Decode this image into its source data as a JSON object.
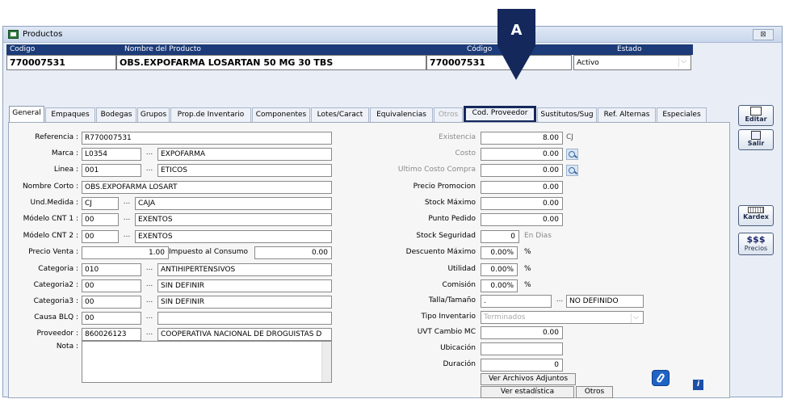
{
  "window": {
    "title": "Productos",
    "close": "⊠"
  },
  "header": {
    "codigo_label": "Codigo",
    "nombre_label": "Nombre del Producto",
    "codigo2_label": "Código",
    "estado_label": "Estado",
    "codigo_value": "770007531",
    "nombre_value": "OBS.EXPOFARMA LOSARTAN 50 MG 30 TBS",
    "codigo2_value": "770007531",
    "estado_value": "Activo"
  },
  "callout": {
    "text": "A"
  },
  "tabs": [
    "General",
    "Empaques",
    "Bodegas",
    "Grupos",
    "Prop.de Inventario",
    "Componentes",
    "Lotes/Caract",
    "Equivalencias",
    "Otros",
    "Cod. Proveedor",
    "Sustitutos/Sug",
    "Ref. Alternas",
    "Especiales"
  ],
  "left": {
    "referencia_label": "Referencia :",
    "referencia": "R770007531",
    "marca_label": "Marca :",
    "marca_code": "L0354",
    "marca_name": "EXPOFARMA",
    "linea_label": "Linea :",
    "linea_code": "001",
    "linea_name": "ETICOS",
    "nombre_corto_label": "Nombre Corto :",
    "nombre_corto": "OBS.EXPOFARMA LOSART",
    "und_label": "Und.Medida :",
    "und_code": "CJ",
    "und_name": "CAJA",
    "cnt1_label": "Módelo CNT 1 :",
    "cnt1_code": "00",
    "cnt1_name": "EXENTOS",
    "cnt2_label": "Módelo CNT 2 :",
    "cnt2_code": "00",
    "cnt2_name": "EXENTOS",
    "precio_label": "Precio Venta :",
    "precio": "1.00",
    "impuesto_label": "Impuesto al Consumo",
    "impuesto": "0.00",
    "cat_label": "Categoria :",
    "cat_code": "010",
    "cat_name": "ANTIHIPERTENSIVOS",
    "cat2_label": "Categoria2 :",
    "cat2_code": "00",
    "cat2_name": "SIN DEFINIR",
    "cat3_label": "Categoria3 :",
    "cat3_code": "00",
    "cat3_name": "SIN DEFINIR",
    "causa_label": "Causa BLQ :",
    "causa_code": "00",
    "causa_name": "",
    "proveedor_label": "Proveedor :",
    "proveedor_code": "860026123",
    "proveedor_name": "COOPERATIVA NACIONAL DE DROGUISTAS D",
    "nota_label": "Nota :",
    "dots": "..."
  },
  "right": {
    "existencia_label": "Existencia",
    "existencia": "8.00",
    "existencia_unit": "CJ",
    "costo_label": "Costo",
    "costo": "0.00",
    "ultimo_costo_label": "Ultimo Costo Compra",
    "ultimo_costo": "0.00",
    "precio_promo_label": "Precio Promocion",
    "precio_promo": "0.00",
    "stock_max_label": "Stock Máximo",
    "stock_max": "0.00",
    "punto_pedido_label": "Punto Pedido",
    "punto_pedido": "0.00",
    "stock_seg_label": "Stock Seguridad",
    "stock_seg": "0",
    "stock_seg_unit": "En Dias",
    "desc_max_label": "Descuento Máximo",
    "desc_max": "0.00%",
    "desc_unit": "%",
    "utilidad_label": "Utilidad",
    "utilidad": "0.00%",
    "utilidad_unit": "%",
    "comision_label": "Comisión",
    "comision": "0.00%",
    "comision_unit": "%",
    "talla_label": "Talla/Tamaño",
    "talla_code": ".",
    "talla_name": "NO DEFINIDO",
    "tipo_label": "Tipo Inventario",
    "tipo_value": "Terminados",
    "uvt_label": "UVT Cambio MC",
    "uvt": "0.00",
    "ubicacion_label": "Ubicación",
    "ubicacion": "",
    "duracion_label": "Duración",
    "duracion": "0",
    "btn_adjuntos": "Ver Archivos Adjuntos",
    "btn_estadistica": "Ver estadística",
    "btn_otros": "Otros"
  },
  "sidebar": {
    "editar": "Editar",
    "salir": "Salir",
    "kardex": "Kardex",
    "precios_top": "$$$",
    "precios": "Precios"
  }
}
